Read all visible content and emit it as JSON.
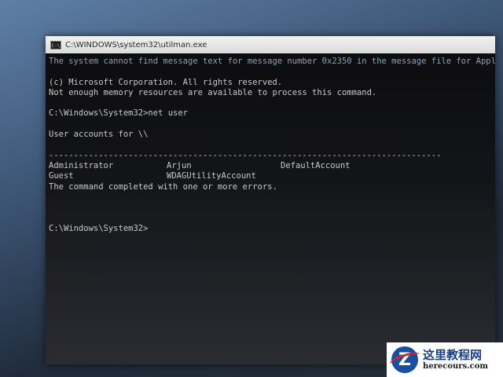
{
  "window": {
    "title": "C:\\WINDOWS\\system32\\utilman.exe",
    "icon": "cmd-icon"
  },
  "console": {
    "line_error_msg": "The system cannot find message text for message number 0x2350 in the message file for Application.",
    "line_copyright": "(c) Microsoft Corporation. All rights reserved.",
    "line_memory": "Not enough memory resources are available to process this command.",
    "line_prompt_cmd": "C:\\Windows\\System32>net user",
    "line_accounts_header": "User accounts for \\\\",
    "line_separator": "-------------------------------------------------------------------------------",
    "accounts_row1": [
      "Administrator",
      "Arjun",
      "DefaultAccount"
    ],
    "accounts_row2": [
      "Guest",
      "WDAGUtilityAccount",
      ""
    ],
    "line_completed": "The command completed with one or more errors.",
    "final_prompt": "C:\\Windows\\System32>"
  },
  "watermark": {
    "logo_letter": "Z",
    "cn_text": "这里教程网",
    "en_text": "herecours.com"
  }
}
